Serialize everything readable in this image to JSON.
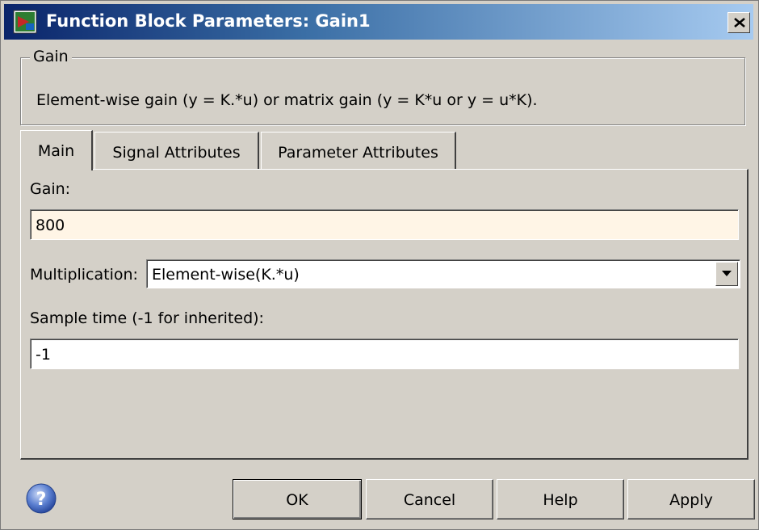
{
  "window": {
    "title": "Function Block Parameters: Gain1",
    "icon": "simulink-block-icon",
    "close_icon": "close-icon"
  },
  "group": {
    "legend": "Gain",
    "description": "Element-wise gain (y = K.*u) or matrix gain (y = K*u or y = u*K)."
  },
  "tabs": [
    {
      "label": "Main",
      "selected": true
    },
    {
      "label": "Signal Attributes",
      "selected": false
    },
    {
      "label": "Parameter Attributes",
      "selected": false
    }
  ],
  "main": {
    "gain_label": "Gain:",
    "gain_value": "800",
    "multiplication_label": "Multiplication:",
    "multiplication_value": "Element-wise(K.*u)",
    "sample_time_label": "Sample time (-1 for inherited):",
    "sample_time_value": "-1"
  },
  "buttons": {
    "ok": "OK",
    "cancel": "Cancel",
    "help": "Help",
    "apply": "Apply"
  },
  "colors": {
    "dialog_bg": "#d4d0c8",
    "gain_field_bg": "#fff5e6",
    "titlebar_start": "#0a246a",
    "titlebar_end": "#a6caf0"
  }
}
